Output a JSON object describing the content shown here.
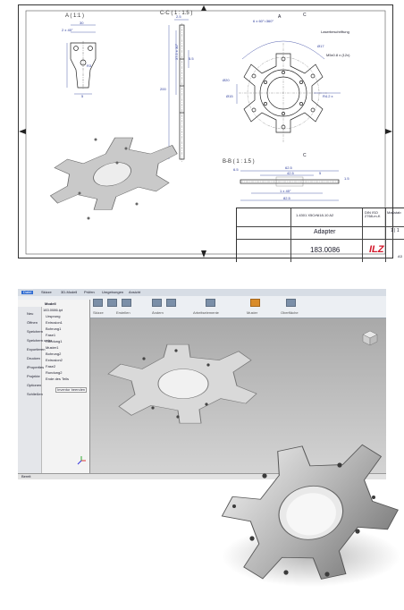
{
  "drawing": {
    "view_a": "A ( 1:1 )",
    "view_c": "C-C ( 1 : 1.5 )",
    "view_b": "B-B ( 1 : 1.5 )",
    "dims_a": [
      "30",
      "2 x 45°",
      "R3",
      "5"
    ],
    "dims_c": [
      "2.5",
      "37.5 ± 30°",
      "5.5",
      "200"
    ],
    "dims_top": [
      "6 x 60°=360°",
      "Ø17",
      "Ø20",
      "Ø15",
      "R4.2 x"
    ],
    "dims_b": [
      "6.5",
      "62.5",
      "5",
      "1 x 45°",
      "82.5",
      "42.5",
      "1.5"
    ],
    "note_laser": "Laserbeschriftung",
    "note_thread": "M5x0.8 x (12x)",
    "section_labels": [
      "A",
      "C",
      "C"
    ],
    "title_block": {
      "material": "1.4301 X5CrNi18-10 A2",
      "title": "Adapter",
      "number": "183.0086",
      "logo": "ILZ",
      "scale_label": "Maßstab",
      "sheet": "1 | 1",
      "format": "A3",
      "norm": "DIN ISO 2768-m-K"
    },
    "edge_letters": [
      "A",
      "B",
      "C"
    ],
    "edge_numbers": [
      "1",
      "2",
      "3",
      "4"
    ]
  },
  "cad_app": {
    "tabs": [
      "Datei",
      "Skizze",
      "3D-Modell",
      "Prüfen",
      "Umgebungen",
      "Ansicht"
    ],
    "ribbon_groups": [
      "Skizze",
      "Erstellen",
      "Ändern",
      "Arbeitselemente",
      "Muster",
      "Oberfläche"
    ],
    "browser_title": "Modell",
    "browser_items": [
      "183.0086.ipt",
      "Ursprung",
      "Extrusion1",
      "Bohrung1",
      "Fase1",
      "Rundung1",
      "Muster1",
      "Bohrung2",
      "Extrusion2",
      "Fase2",
      "Rundung2",
      "Ende des Teils"
    ],
    "left_panel": [
      "Neu",
      "Öffnen",
      "Speichern",
      "Speichern unter",
      "Exportieren",
      "Drucken",
      "iProperties",
      "Projekte",
      "Optionen",
      "Schließen"
    ],
    "status_text": "Bereit",
    "ok_label": "Inventor beenden",
    "accent": "#2e6bd1"
  }
}
